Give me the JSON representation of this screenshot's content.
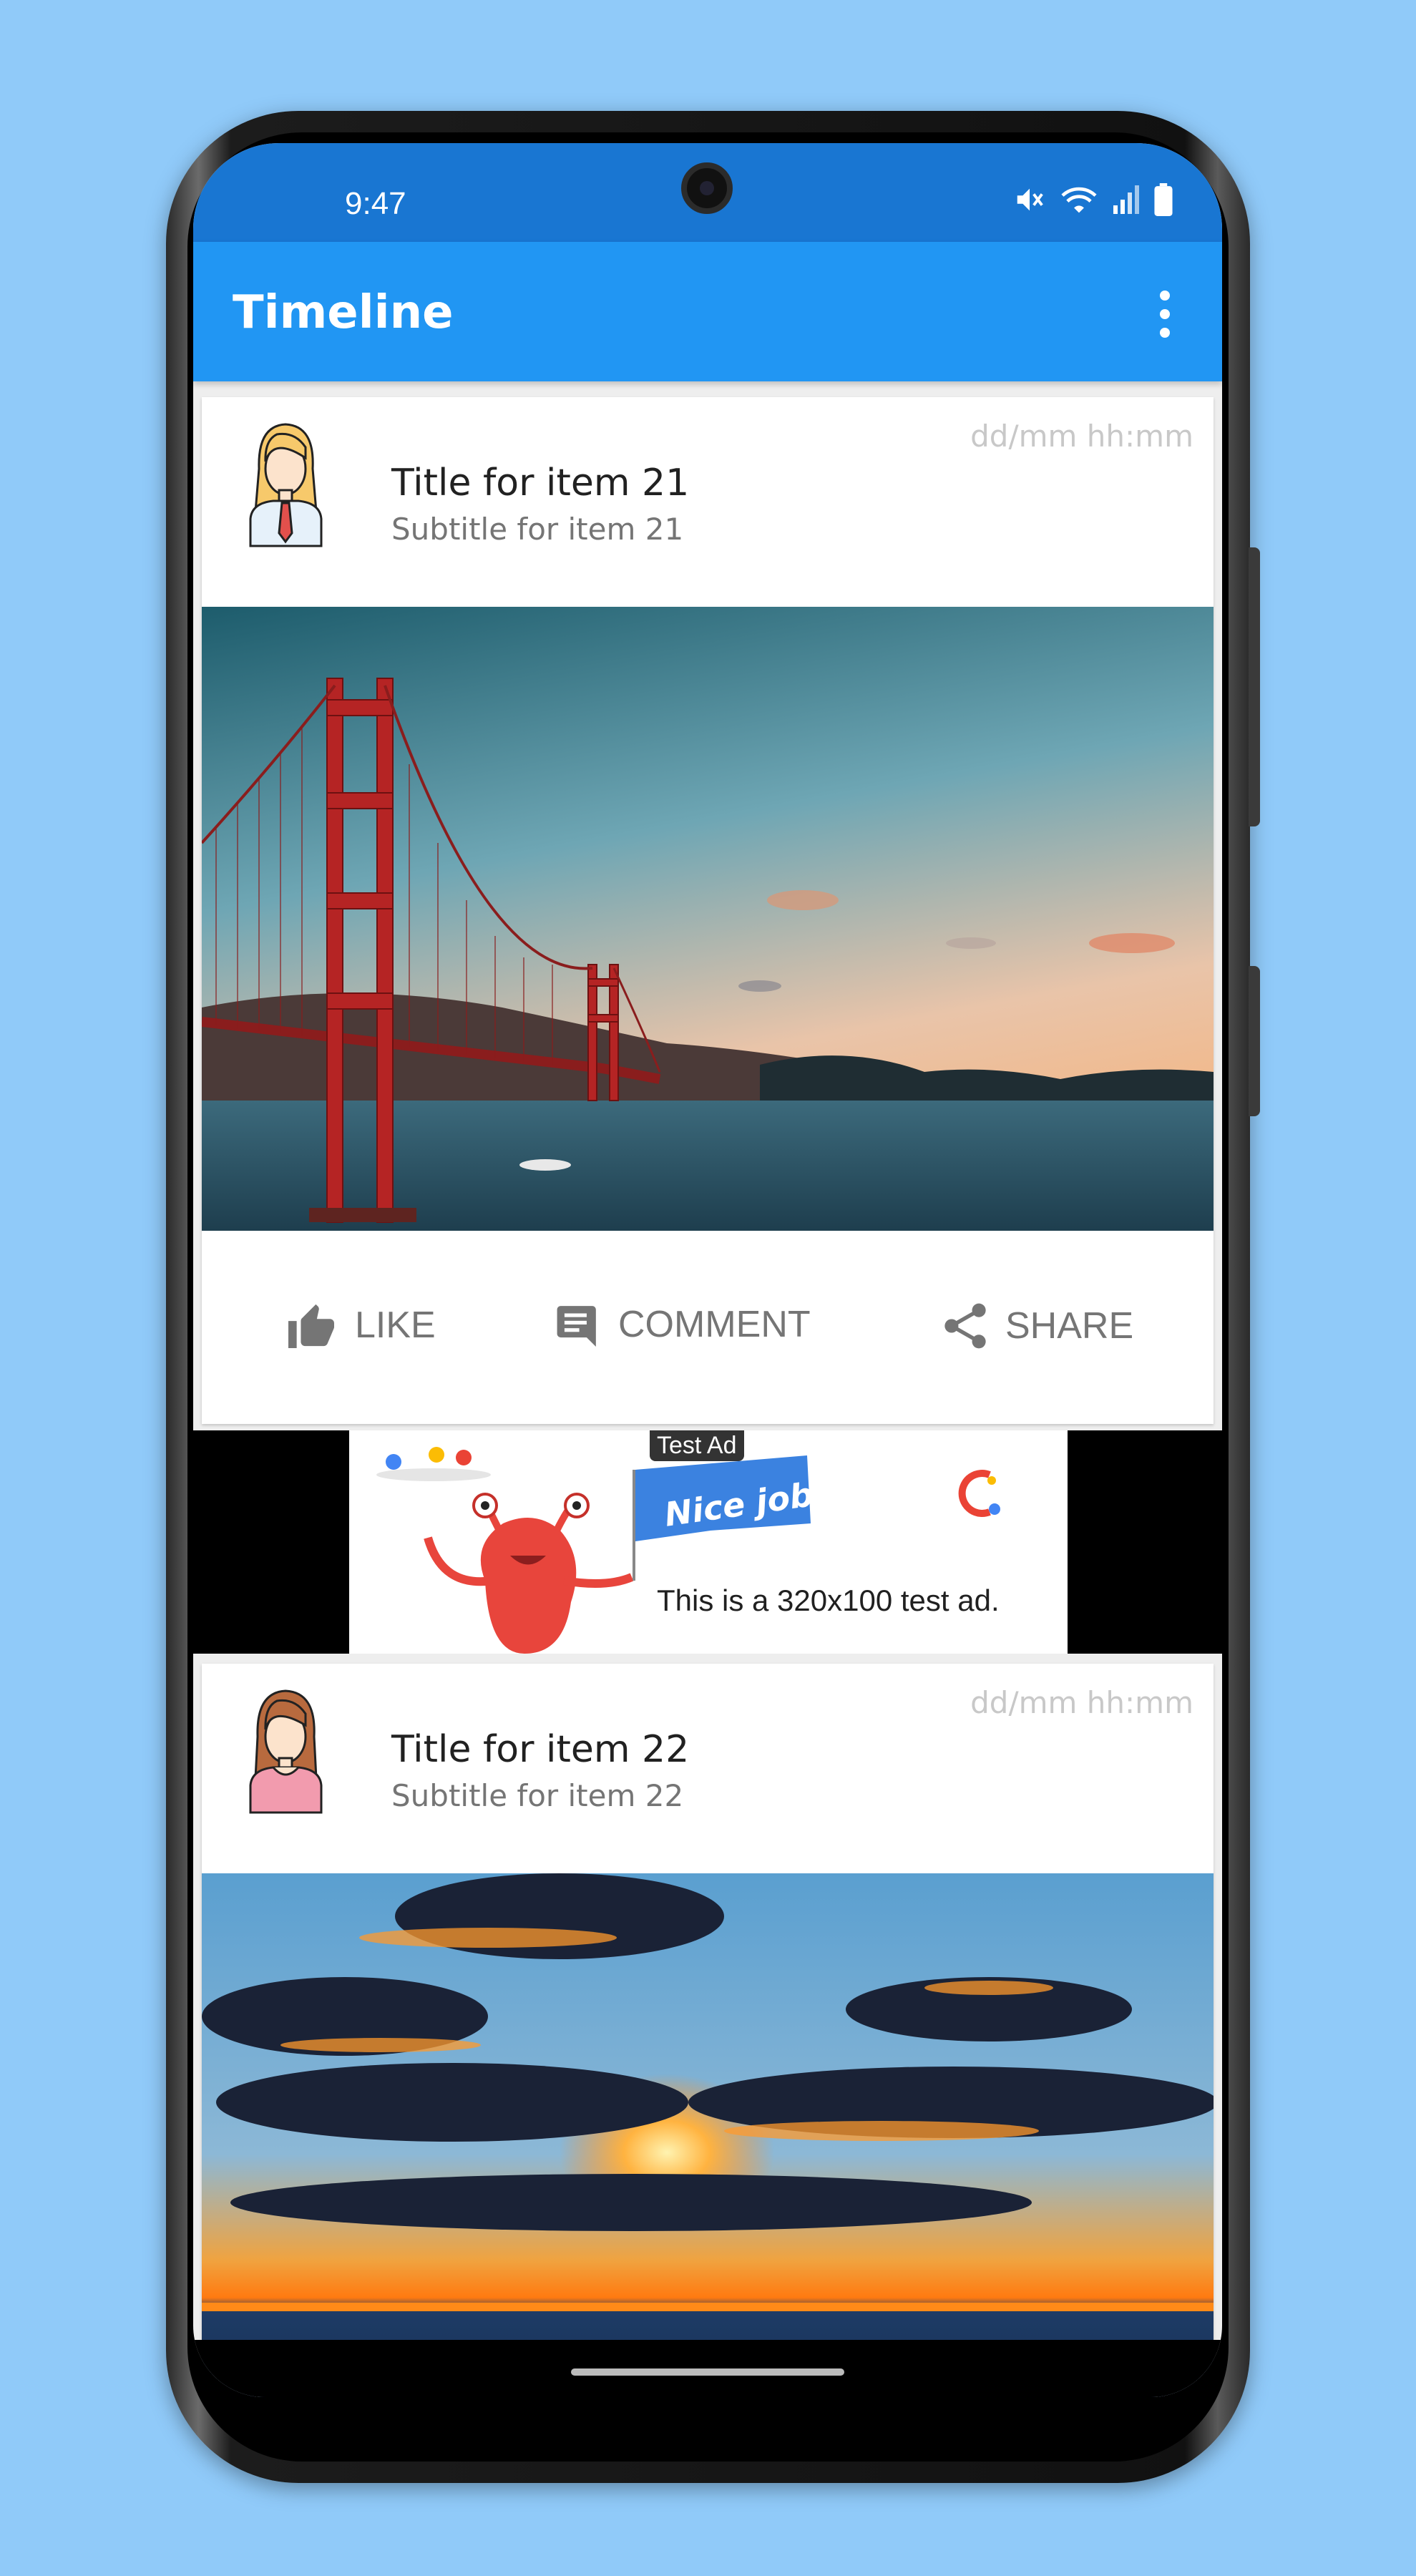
{
  "status_bar": {
    "time": "9:47",
    "icons": [
      "mute-icon",
      "wifi-icon",
      "signal-icon",
      "battery-icon"
    ]
  },
  "app_bar": {
    "title": "Timeline",
    "menu_icon": "more-vert-icon"
  },
  "posts": [
    {
      "title": "Title for item 21",
      "subtitle": "Subtitle for item 21",
      "date": "dd/mm hh:mm",
      "avatar": "avatar-blonde-woman-icon",
      "image": "golden-gate-bridge-photo"
    },
    {
      "title": "Title for item 22",
      "subtitle": "Subtitle for item 22",
      "date": "dd/mm hh:mm",
      "avatar": "avatar-brunette-woman-icon",
      "image": "ocean-sunset-photo"
    }
  ],
  "actions": {
    "like": "LIKE",
    "comment": "COMMENT",
    "share": "SHARE"
  },
  "ad": {
    "label": "Test Ad",
    "banner": "Nice job!",
    "text": "This is a 320x100 test ad."
  },
  "colors": {
    "background": "#90CAF9",
    "status_bar": "#1976D2",
    "app_bar": "#2196F3",
    "action_gray": "#757575"
  }
}
